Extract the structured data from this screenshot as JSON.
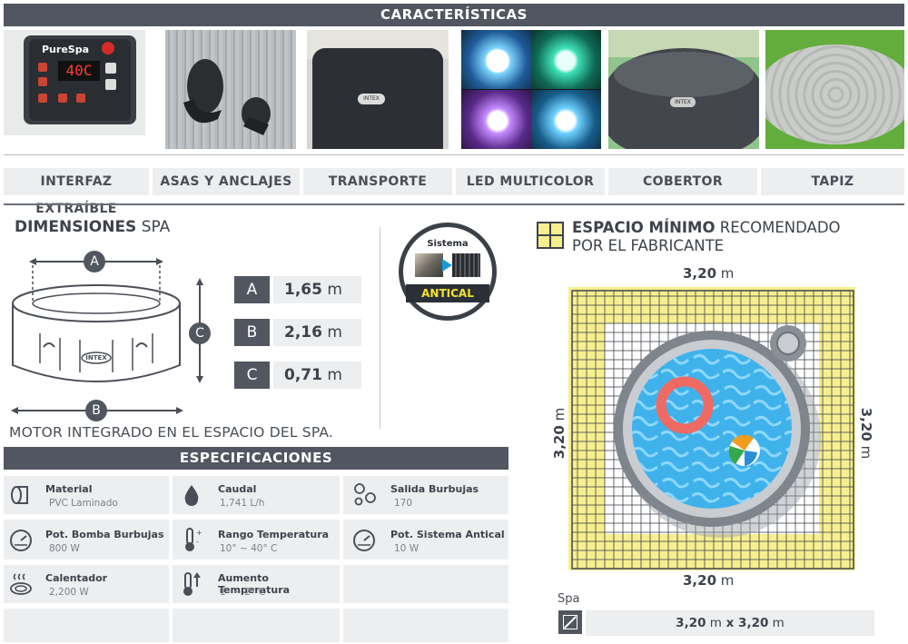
{
  "features": {
    "title": "CARACTERÍSTICAS",
    "items": [
      {
        "label": "INTERFAZ EXTRAÍBLE"
      },
      {
        "label": "ASAS Y ANCLAJES"
      },
      {
        "label": "TRANSPORTE"
      },
      {
        "label": "LED MULTICOLOR"
      },
      {
        "label": "COBERTOR"
      },
      {
        "label": "TAPIZ"
      }
    ],
    "panel_brand": "PureSpa",
    "panel_display": "40C",
    "cover_brand": "INTEX"
  },
  "dimensions": {
    "title_bold": "DIMENSIONES",
    "title_rest": " SPA",
    "rows": [
      {
        "letter": "A",
        "value": "1,65",
        "unit": " m"
      },
      {
        "letter": "B",
        "value": "2,16",
        "unit": " m"
      },
      {
        "letter": "C",
        "value": "0,71",
        "unit": " m"
      }
    ],
    "diagram_labels": {
      "a": "A",
      "b": "B",
      "c": "C",
      "brand": "INTEX"
    },
    "motor_note": "MOTOR INTEGRADO EN EL ESPACIO DEL SPA."
  },
  "antical_badge": {
    "top": "Sistema",
    "bottom": "ANTICAL"
  },
  "space": {
    "title_bold": "ESPACIO MÍNIMO",
    "title_rest": " RECOMENDADO",
    "title_line2": "POR EL FABRICANTE",
    "top": {
      "value": "3,20",
      "unit": " m"
    },
    "bottom": {
      "value": "3,20",
      "unit": " m"
    },
    "left": {
      "value": "3,20",
      "unit": " m"
    },
    "right": {
      "value": "3,20",
      "unit": " m"
    },
    "spa_caption": "Spa",
    "summary": {
      "v1": "3,20",
      "u1": " m",
      "x": " x ",
      "v2": "3,20",
      "u2": " m"
    }
  },
  "specs": {
    "title": "ESPECIFICACIONES",
    "items": [
      {
        "label": "Material",
        "value": "PVC Laminado",
        "icon": "roll-icon"
      },
      {
        "label": "Caudal",
        "value": "1,741 L/h",
        "icon": "drop-icon"
      },
      {
        "label": "Salida Burbujas",
        "value": "170",
        "icon": "bubbles-icon"
      },
      {
        "label": "Pot. Bomba Burbujas",
        "value": "800 W",
        "icon": "gauge-icon"
      },
      {
        "label": "Rango Temperatura",
        "value": "10° ~ 40° C",
        "icon": "thermometer-range-icon"
      },
      {
        "label": "Pot. Sistema Antical",
        "value": "10 W",
        "icon": "gauge-icon"
      },
      {
        "label": "Calentador",
        "value": "2,200 W",
        "icon": "heater-icon"
      },
      {
        "label": "Aumento Temperatura",
        "value": "1° ~ 2° C",
        "icon": "thermometer-up-icon"
      }
    ]
  },
  "colors": {
    "dark_bar": "#515660",
    "light_cell": "#eceef0",
    "grid_yellow": "#f7ef8f",
    "water": "#3fb2ec"
  }
}
